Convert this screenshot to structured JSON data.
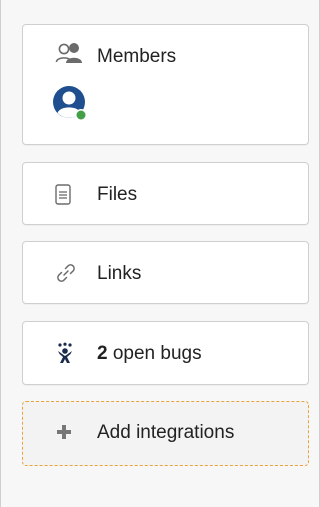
{
  "members": {
    "label": "Members",
    "icon": "members-icon",
    "avatar_online_color": "#43a047"
  },
  "files": {
    "label": "Files",
    "icon": "file-icon"
  },
  "links": {
    "label": "Links",
    "icon": "link-icon"
  },
  "bugs": {
    "count": "2",
    "label": "open bugs",
    "icon": "bug-icon"
  },
  "add_integrations": {
    "label": "Add integrations",
    "icon": "plus-icon"
  }
}
